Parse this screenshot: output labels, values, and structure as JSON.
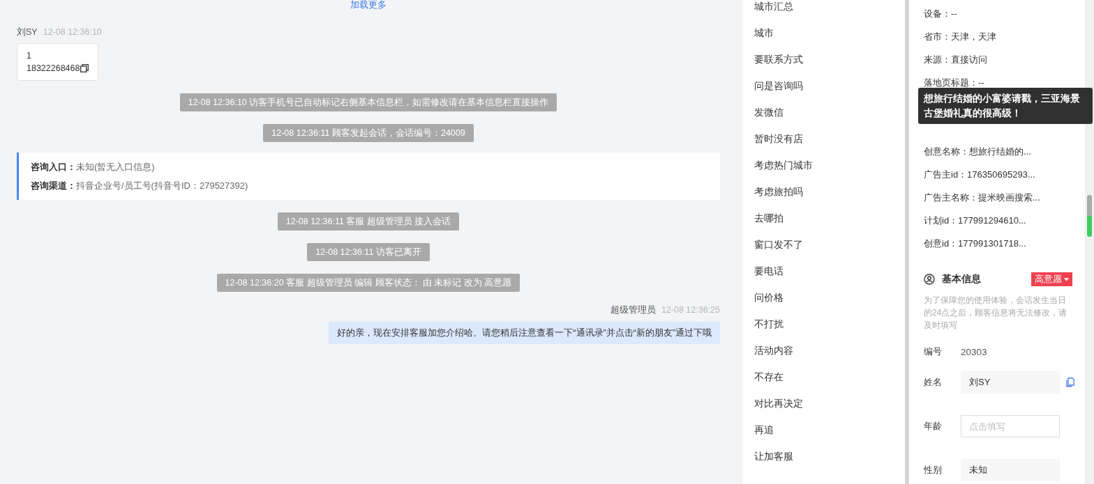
{
  "chat": {
    "load_more": "加载更多",
    "messages": [
      {
        "kind": "visitor",
        "sender": "刘SY",
        "time": "12-08 12:36:10",
        "lines": [
          "1",
          "18322268468"
        ]
      },
      {
        "kind": "notice",
        "text": "12-08 12:36:10 访客手机号已自动标记右侧基本信息栏，如需修改请在基本信息栏直接操作"
      },
      {
        "kind": "notice",
        "text": "12-08 12:36:11 顾客发起会话，会话编号：24009"
      },
      {
        "kind": "entry_card",
        "rows": [
          {
            "label": "咨询入口：",
            "value": "未知(暂无入口信息)"
          },
          {
            "label": "咨询渠道：",
            "value": "抖音企业号/员工号(抖音号ID：279527392)"
          }
        ]
      },
      {
        "kind": "notice",
        "text": "12-08 12:36:11 客服 超级管理员 接入会话"
      },
      {
        "kind": "notice",
        "text": "12-08 12:36:11 访客已离开"
      },
      {
        "kind": "notice",
        "text": "12-08 12:36:20 客服 超级管理员 编辑 顾客状态： 由 未标记 改为 高意愿"
      },
      {
        "kind": "agent",
        "sender": "超级管理员",
        "time": "12-08 12:36:25",
        "text": "好的亲，现在安排客服加您介绍哈。请您稍后注意查看一下“通讯录”并点击“新的朋友”通过下哦"
      }
    ]
  },
  "tag_list": {
    "items": [
      "城市汇总",
      "城市",
      "要联系方式",
      "问是咨询吗",
      "发微信",
      "暂时没有店",
      "考虑热门城市",
      "考虑旅拍吗",
      "去哪拍",
      "窗口发不了",
      "要电话",
      "问价格",
      "不打扰",
      "活动内容",
      "不存在",
      "对比再决定",
      "再追",
      "让加客服"
    ]
  },
  "details": {
    "rows_top": [
      "设备：--",
      "省市：天津，天津",
      "来源：直接访问",
      "落地页标题：--"
    ],
    "tooltip": "想旅行结婚的小富婆请戳，三亚海景古堡婚礼真的很高级！",
    "rows_bottom": [
      "创意名称：想旅行结婚的...",
      "广告主id：176350695293...",
      "广告主名称：提米映画搜索...",
      "计划id：177991294610...",
      "创意id：177991301718..."
    ],
    "basic_info": {
      "title": "基本信息",
      "status_tag": "高意愿",
      "note": "为了保障您的使用体验，会话发生当日的24点之后，顾客信息将无法修改，请及时填写",
      "fields": [
        {
          "kind": "text",
          "label": "编号",
          "value": "20303"
        },
        {
          "kind": "input",
          "label": "姓名",
          "value": "刘SY",
          "copy": true
        },
        {
          "kind": "input",
          "label": "年龄",
          "placeholder": "点击填写"
        },
        {
          "kind": "input",
          "label": "性别",
          "value": "未知"
        }
      ]
    }
  }
}
